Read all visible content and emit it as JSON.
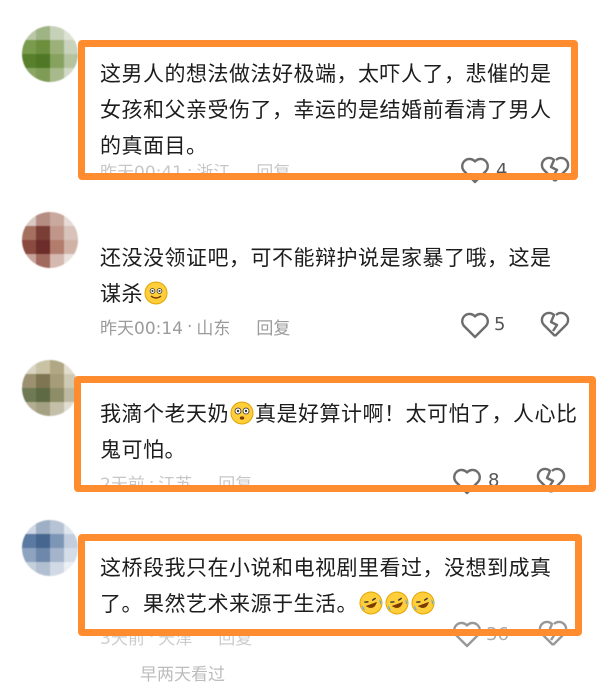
{
  "comments": [
    {
      "text": "这男人的想法做法好极端，太吓人了，悲催的是女孩和父亲受伤了，幸运的是结婚前看清了男人的真面目。",
      "time": "昨天00:41",
      "location": "浙江",
      "reply": "回复",
      "likes": "4",
      "highlighted": true
    },
    {
      "text": "还没没领证吧，可不能辩护说是家暴了哦，这是谋杀",
      "emoji": "grinning-face-emoji",
      "time": "昨天00:14",
      "location": "山东",
      "reply": "回复",
      "likes": "5",
      "highlighted": false
    },
    {
      "text_before": "我滴个老天奶",
      "emoji": "flushed-face-emoji",
      "text_after": "真是好算计啊！太可怕了，人心比鬼可怕。",
      "time": "2天前",
      "location": "江苏",
      "reply": "回复",
      "likes": "8",
      "highlighted": true
    },
    {
      "text": "这桥段我只在小说和电视剧里看过，没想到成真了。果然艺术来源于生活。",
      "emoji": "rolling-laughing-emoji ×3",
      "time": "3天前",
      "location": "天津",
      "reply": "回复",
      "likes": "36",
      "highlighted": true
    }
  ],
  "partial_next_line": "早两天看过",
  "colors": {
    "highlight": "#ff8c2e",
    "meta_text": "#9b9b9b",
    "body_text": "#1d1d1d"
  }
}
